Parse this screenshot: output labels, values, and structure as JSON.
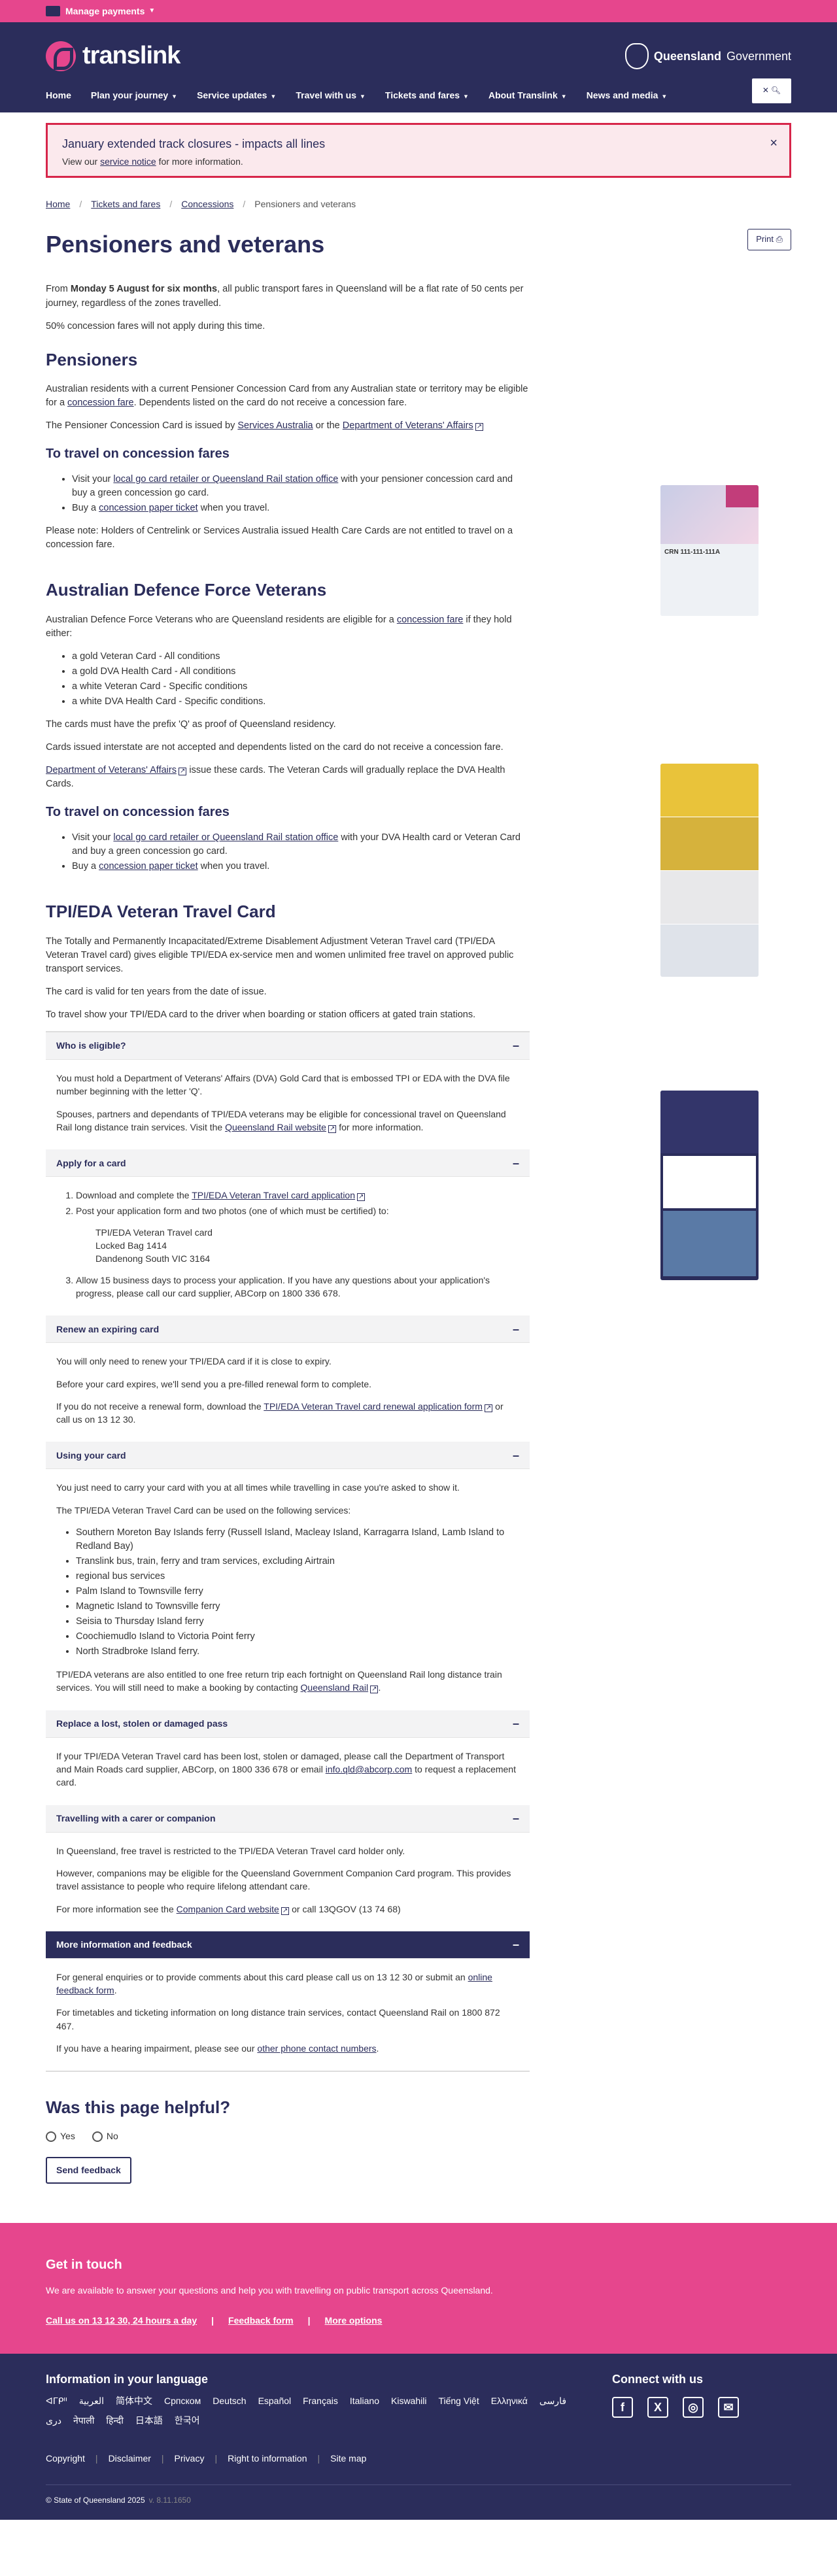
{
  "topbar": {
    "label": "Manage payments"
  },
  "header": {
    "brand": "translink",
    "gov_bold": "Queensland",
    "gov": "Government"
  },
  "nav": [
    {
      "label": "Home",
      "chev": false
    },
    {
      "label": "Plan your journey",
      "chev": true
    },
    {
      "label": "Service updates",
      "chev": true
    },
    {
      "label": "Travel with us",
      "chev": true
    },
    {
      "label": "Tickets and fares",
      "chev": true
    },
    {
      "label": "About Translink",
      "chev": true
    },
    {
      "label": "News and media",
      "chev": true
    }
  ],
  "alert": {
    "title": "January extended track closures - impacts all lines",
    "pre": "View our",
    "link": "service notice",
    "post": "for more information."
  },
  "breadcrumbs": [
    "Home",
    "Tickets and fares",
    "Concessions",
    "Pensioners and veterans"
  ],
  "page": {
    "title": "Pensioners and veterans",
    "print": "Print"
  },
  "intro": {
    "p1_a": "From",
    "p1_b": "Monday 5 August for six months",
    "p1_c": ", all public transport fares in Queensland will be a flat rate of 50 cents per journey, regardless of the zones travelled.",
    "p2": "50% concession fares will not apply during this time."
  },
  "pensioners": {
    "title": "Pensioners",
    "p1_a": "Australian residents with a current Pensioner Concession Card from any Australian state or territory may be eligible for a",
    "p1_link": "concession fare",
    "p1_b": ". Dependents listed on the card do not receive a concession fare.",
    "p2_a": "The Pensioner Concession Card is issued by",
    "p2_link1": "Services Australia",
    "p2_or": "or the",
    "p2_link2": "Department of Veterans' Affairs",
    "card_text": "CRN 111-111-111A",
    "travel_title": "To travel on concession fares",
    "li1_a": "Visit your",
    "li1_link": "local go card retailer or Queensland Rail station office",
    "li1_b": "with your pensioner concession card and buy a green concession go card.",
    "li2_a": "Buy a",
    "li2_link": "concession paper ticket",
    "li2_b": "when you travel.",
    "note": "Please note: Holders of Centrelink or Services Australia issued Health Care Cards are not entitled to travel on a concession fare."
  },
  "adf": {
    "title": "Australian Defence Force Veterans",
    "p1_a": "Australian Defence Force Veterans who are Queensland residents are eligible for a",
    "p1_link": "concession fare",
    "p1_b": "if they hold either:",
    "list": [
      "a gold Veteran Card - All conditions",
      "a gold DVA Health Card - All conditions",
      "a white Veteran Card - Specific conditions",
      "a white DVA Health Card - Specific conditions."
    ],
    "p2": "The cards must have the prefix 'Q' as proof of Queensland residency.",
    "p3": "Cards issued interstate are not accepted and dependents listed on the card do not receive a concession fare.",
    "p4_link": "Department of Veterans' Affairs",
    "p4_b": "issue these cards. The Veteran Cards will gradually replace the DVA Health Cards.",
    "travel_title": "To travel on concession fares",
    "li1_a": "Visit your",
    "li1_link": "local go card retailer or Queensland Rail station office",
    "li1_b": "with your DVA Health card or Veteran Card and buy a green concession go card.",
    "li2_a": "Buy a",
    "li2_link": "concession paper ticket",
    "li2_b": "when you travel."
  },
  "tpi": {
    "title": "TPI/EDA Veteran Travel Card",
    "p1": "The Totally and Permanently Incapacitated/Extreme Disablement Adjustment Veteran Travel card (TPI/EDA Veteran Travel card) gives eligible TPI/EDA ex-service men and women unlimited free travel on approved public transport services.",
    "p2": "The card is valid for ten years from the date of issue.",
    "p3": "To travel show your TPI/EDA card to the driver when boarding or station officers at gated train stations."
  },
  "acc1": {
    "title": "Who is eligible?",
    "p1": "You must hold a Department of Veterans' Affairs (DVA) Gold Card that is embossed TPI or EDA with the DVA file number beginning with the letter 'Q'.",
    "p2_a": "Spouses, partners and dependants of TPI/EDA veterans may be eligible for concessional travel on Queensland Rail long distance train services. Visit the",
    "p2_link": "Queensland Rail website",
    "p2_b": "for more information."
  },
  "acc2": {
    "title": "Apply for a card",
    "li1_a": "Download and complete the",
    "li1_link": "TPI/EDA Veteran Travel card application",
    "li2": "Post your application form and two photos (one of which must be certified) to:",
    "addr1": "TPI/EDA Veteran Travel card",
    "addr2": "Locked Bag 1414",
    "addr3": "Dandenong South VIC 3164",
    "li3": "Allow 15 business days to process your application. If you have any questions about your application's progress, please call our card supplier, ABCorp on 1800 336 678."
  },
  "acc3": {
    "title": "Renew an expiring card",
    "p1": "You will only need to renew your TPI/EDA card if it is close to expiry.",
    "p2": "Before your card expires, we'll send you a pre-filled renewal form to complete.",
    "p3_a": "If you do not receive a renewal form, download the",
    "p3_link": "TPI/EDA Veteran Travel card renewal application form",
    "p3_b": "or call us on 13 12 30."
  },
  "acc4": {
    "title": "Using your card",
    "p1": "You just need to carry your card with you at all times while travelling in case you're asked to show it.",
    "p2": "The TPI/EDA Veteran Travel Card can be used on the following services:",
    "list": [
      "Southern Moreton Bay Islands ferry (Russell Island, Macleay Island, Karragarra Island, Lamb Island to Redland Bay)",
      "Translink bus, train, ferry and tram services, excluding Airtrain",
      "regional bus services",
      "Palm Island to Townsville ferry",
      "Magnetic Island to Townsville ferry",
      "Seisia to Thursday Island ferry",
      "Coochiemudlo Island to Victoria Point ferry",
      "North Stradbroke Island ferry."
    ],
    "p3_a": "TPI/EDA veterans are also entitled to one free return trip each fortnight on Queensland Rail long distance train services. You will still need to make a booking by contacting",
    "p3_link": "Queensland Rail",
    "p3_b": "."
  },
  "acc5": {
    "title": "Replace a lost, stolen or damaged pass",
    "p1_a": "If your TPI/EDA Veteran Travel card has been lost, stolen or damaged, please call the Department of Transport and Main Roads card supplier, ABCorp, on 1800 336 678 or email",
    "p1_link": "info.qld@abcorp.com",
    "p1_b": "to request a replacement card."
  },
  "acc6": {
    "title": "Travelling with a carer or companion",
    "p1": "In Queensland, free travel is restricted to the TPI/EDA Veteran Travel card holder only.",
    "p2": "However, companions may be eligible for the Queensland Government Companion Card program. This provides travel assistance to people who require lifelong attendant care.",
    "p3_a": "For more information see the",
    "p3_link": "Companion Card website",
    "p3_b": "or call 13QGOV (13 74 68)"
  },
  "acc7": {
    "title": "More information and feedback",
    "p1_a": "For general enquiries or to provide comments about this card please call us on 13 12 30 or submit an",
    "p1_link": "online feedback form",
    "p1_b": ".",
    "p2": "For timetables and ticketing information on long distance train services, contact Queensland Rail on 1800 872 467.",
    "p3_a": "If you have a hearing impairment, please see our",
    "p3_link": "other phone contact numbers",
    "p3_b": "."
  },
  "helpful": {
    "title": "Was this page helpful?",
    "yes": "Yes",
    "no": "No",
    "send": "Send feedback"
  },
  "getintouch": {
    "title": "Get in touch",
    "text": "We are available to answer your questions and help you with travelling on public transport across Queensland.",
    "links": [
      "Call us on 13 12 30, 24 hours a day",
      "Feedback form",
      "More options"
    ]
  },
  "footer": {
    "lang_title": "Information in your language",
    "languages": [
      "ᐊᒥᑭᐦ",
      "العربية",
      "简体中文",
      "Српском",
      "Deutsch",
      "Español",
      "Français",
      "Italiano",
      "Kiswahili",
      "Tiếng Việt",
      "Ελληνικά",
      "فارسی",
      "دری",
      "नेपाली",
      "हिन्दी",
      "日本語",
      "한국어"
    ],
    "connect_title": "Connect with us",
    "links": [
      "Copyright",
      "Disclaimer",
      "Privacy",
      "Right to information",
      "Site map"
    ],
    "copyright": "© State of Queensland 2025",
    "version": "v. 8.11.1650"
  }
}
